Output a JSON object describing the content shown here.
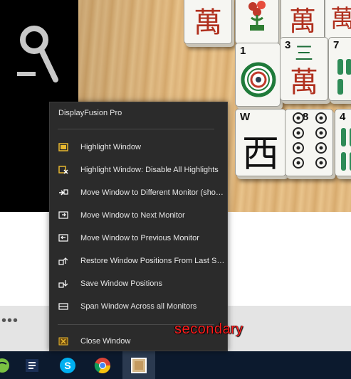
{
  "menu": {
    "title": "DisplayFusion Pro",
    "items": [
      {
        "label": "Highlight Window",
        "icon": "highlight-window-icon"
      },
      {
        "label": "Highlight Window: Disable All Highlights",
        "icon": "disable-highlights-icon"
      },
      {
        "label": "Move Window to Different Monitor (sho…",
        "icon": "move-monitor-icon"
      },
      {
        "label": "Move Window to Next Monitor",
        "icon": "next-monitor-icon"
      },
      {
        "label": "Move Window to Previous Monitor",
        "icon": "previous-monitor-icon"
      },
      {
        "label": "Restore Window Positions From Last Save",
        "icon": "restore-positions-icon"
      },
      {
        "label": "Save Window Positions",
        "icon": "save-positions-icon"
      },
      {
        "label": "Span Window Across all Monitors",
        "icon": "span-window-icon"
      }
    ],
    "close_label": "Close Window"
  },
  "annotation": "secondary",
  "tiles": {
    "t1_num": "1",
    "t2_num": "3",
    "t3_num": "7",
    "t4_num": "W",
    "t5_num": "8",
    "t6_num": "4",
    "wan": "萬",
    "west": "西",
    "three": "三"
  },
  "taskbar": {
    "apps": [
      "app-icon-green",
      "notes-app-icon",
      "skype-icon",
      "chrome-icon",
      "mahjong-app-icon"
    ]
  },
  "colors": {
    "menu_bg": "#2b2b2b",
    "accent_icon": "#e8b830",
    "annotation_red": "#ff1c1c",
    "taskbar": "#0c1a2e"
  }
}
